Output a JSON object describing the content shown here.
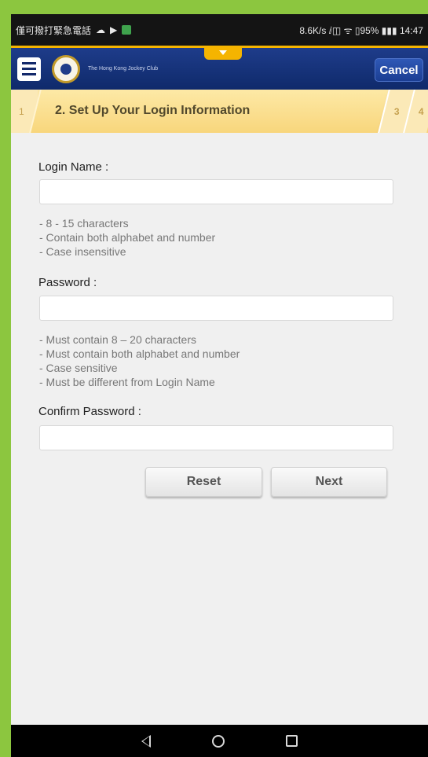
{
  "status_bar": {
    "left_text": "僅可撥打緊急電話",
    "right_text": "8.6K/s ⅈ◫ ᯤ ▯95% ▮▮▮ 14:47"
  },
  "header": {
    "brand": "The Hong Kong Jockey Club",
    "cancel_label": "Cancel"
  },
  "steps": {
    "step1": "1",
    "active": "2. Set Up Your Login Information",
    "step3": "3",
    "step4": "4"
  },
  "form": {
    "login_label": "Login Name :",
    "login_value": "",
    "login_hints": [
      "- 8 - 15 characters",
      "- Contain both alphabet and number",
      "- Case insensitive"
    ],
    "password_label": "Password :",
    "password_value": "",
    "password_hints": [
      "- Must contain 8 – 20 characters",
      "- Must contain both alphabet and number",
      "- Case sensitive",
      "- Must be different from Login Name"
    ],
    "confirm_label": "Confirm Password :",
    "confirm_value": "",
    "reset_label": "Reset",
    "next_label": "Next"
  },
  "colors": {
    "frame": "#8cc63f",
    "header": "#1e3c8a",
    "accent": "#f5b400",
    "step_bar": "#f8d67c"
  }
}
